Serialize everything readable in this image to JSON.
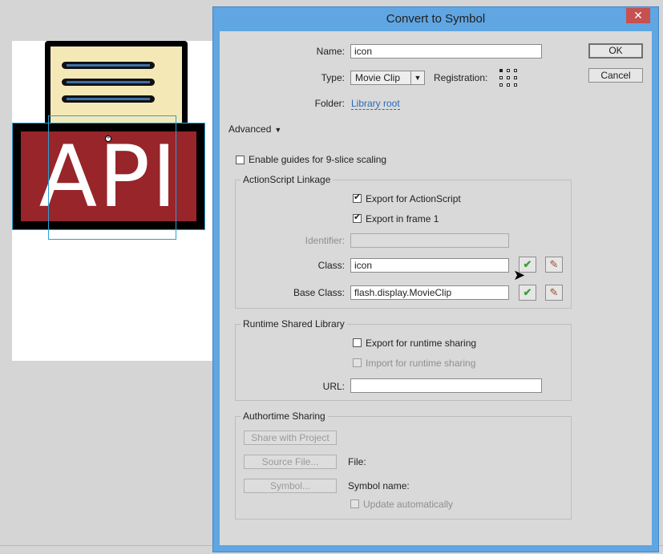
{
  "dialog": {
    "title": "Convert to Symbol",
    "close_glyph": "✕",
    "name_label": "Name:",
    "name_value": "icon",
    "type_label": "Type:",
    "type_value": "Movie Clip",
    "registration_label": "Registration:",
    "folder_label": "Folder:",
    "folder_value": "Library root",
    "advanced_label": "Advanced",
    "ok_label": "OK",
    "cancel_label": "Cancel",
    "nine_slice_label": "Enable guides for 9-slice scaling",
    "nine_slice_checked": false
  },
  "as_linkage": {
    "title": "ActionScript Linkage",
    "export_as_label": "Export for ActionScript",
    "export_as_checked": true,
    "export_frame1_label": "Export in frame 1",
    "export_frame1_checked": true,
    "identifier_label": "Identifier:",
    "identifier_value": "",
    "class_label": "Class:",
    "class_value": "icon",
    "base_class_label": "Base Class:",
    "base_class_value": "flash.display.MovieClip"
  },
  "rsl": {
    "title": "Runtime Shared Library",
    "export_runtime_label": "Export for runtime sharing",
    "export_runtime_checked": false,
    "import_runtime_label": "Import for runtime sharing",
    "import_runtime_checked": false,
    "url_label": "URL:",
    "url_value": ""
  },
  "authortime": {
    "title": "Authortime Sharing",
    "share_project_label": "Share with Project",
    "source_file_label": "Source File...",
    "file_label": "File:",
    "symbol_label": "Symbol...",
    "symbol_name_label": "Symbol name:",
    "update_auto_label": "Update automatically",
    "update_auto_checked": false
  },
  "stage": {
    "artwork_text": "API",
    "icon": "document-api-artwork"
  },
  "icons": {
    "validate": "check-icon",
    "edit": "pencil-icon",
    "dropdown": "chevron-down-icon",
    "advanced_toggle": "triangle-down-icon"
  },
  "colors": {
    "dialog_border": "#5fa6e2",
    "close_button": "#c75050",
    "artwork_red": "#97252a",
    "artwork_paper": "#f4e9b6",
    "link": "#2a6bb8",
    "check_green": "#3aa335"
  }
}
